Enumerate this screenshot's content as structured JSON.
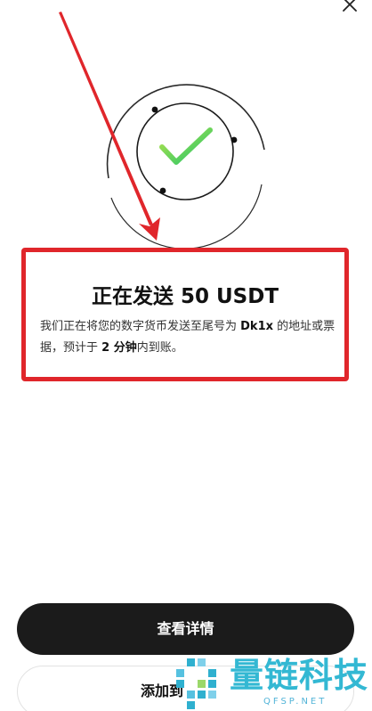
{
  "status": {
    "title": "正在发送 50 USDT",
    "desc": {
      "p1": "我们正在将您的数字货币发送至尾号为 ",
      "suffix": "Dk1x",
      "p2": " 的地址或票据，预计于 ",
      "eta": "2 分钟",
      "p3": "内到账。"
    }
  },
  "actions": {
    "view_details": "查看详情",
    "add_label": "添加到"
  },
  "watermark": {
    "name": "量链科技",
    "domain": "QFSP.NET"
  },
  "icons": {
    "close": "close-icon",
    "success": "checkmark-icon"
  },
  "colors": {
    "highlight_border": "#e0262b",
    "annotation_arrow": "#e0262b",
    "check_start": "#b7e34a",
    "check_end": "#1fc46b",
    "button_dark": "#1b1b1b",
    "watermark": "#33b8d3"
  }
}
